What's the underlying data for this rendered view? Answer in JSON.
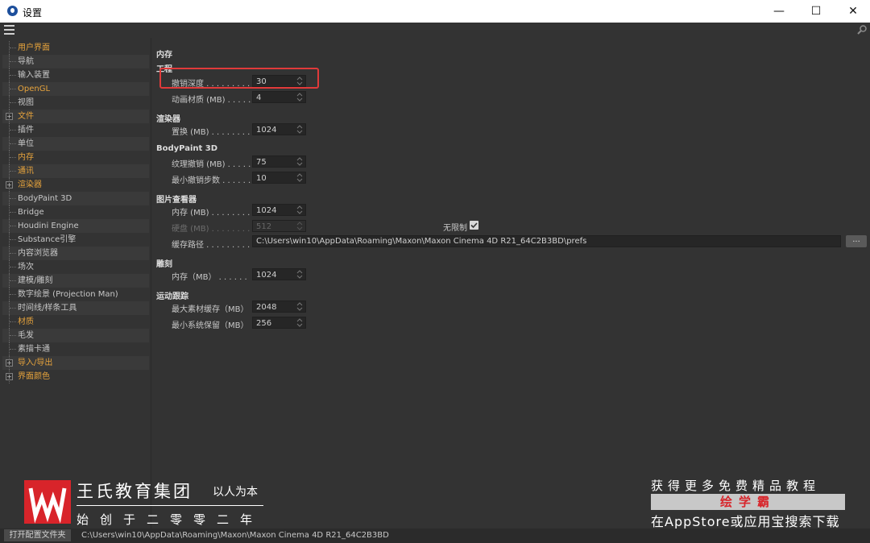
{
  "window": {
    "title": "设置",
    "minimize": "—",
    "maximize": "☐",
    "close": "✕"
  },
  "sidebar": {
    "items": [
      {
        "label": "用户界面",
        "orange": true,
        "expandable": false
      },
      {
        "label": "导航",
        "orange": false,
        "expandable": false
      },
      {
        "label": "输入装置",
        "orange": false,
        "expandable": false
      },
      {
        "label": "OpenGL",
        "orange": true,
        "expandable": false
      },
      {
        "label": "视图",
        "orange": false,
        "expandable": false
      },
      {
        "label": "文件",
        "orange": true,
        "expandable": true
      },
      {
        "label": "插件",
        "orange": false,
        "expandable": false
      },
      {
        "label": "单位",
        "orange": false,
        "expandable": false
      },
      {
        "label": "内存",
        "orange": true,
        "expandable": false
      },
      {
        "label": "通讯",
        "orange": true,
        "expandable": false
      },
      {
        "label": "渲染器",
        "orange": true,
        "expandable": true
      },
      {
        "label": "BodyPaint 3D",
        "orange": false,
        "expandable": false
      },
      {
        "label": "Bridge",
        "orange": false,
        "expandable": false
      },
      {
        "label": "Houdini Engine",
        "orange": false,
        "expandable": false
      },
      {
        "label": "Substance引擎",
        "orange": false,
        "expandable": false
      },
      {
        "label": "内容浏览器",
        "orange": false,
        "expandable": false
      },
      {
        "label": "场次",
        "orange": false,
        "expandable": false
      },
      {
        "label": "建模/雕刻",
        "orange": false,
        "expandable": false
      },
      {
        "label": "数字绘景 (Projection Man)",
        "orange": false,
        "expandable": false
      },
      {
        "label": "时间线/样条工具",
        "orange": false,
        "expandable": false
      },
      {
        "label": "材质",
        "orange": true,
        "expandable": false
      },
      {
        "label": "毛发",
        "orange": false,
        "expandable": false
      },
      {
        "label": "素描卡通",
        "orange": false,
        "expandable": false
      },
      {
        "label": "导入/导出",
        "orange": true,
        "expandable": true
      },
      {
        "label": "界面颜色",
        "orange": true,
        "expandable": true
      }
    ]
  },
  "content": {
    "heading": "内存",
    "project": {
      "heading": "工程",
      "undo_label": "撤销深度",
      "undo_value": "30",
      "anim_label": "动画材质 (MB)",
      "anim_value": "4"
    },
    "renderer": {
      "heading": "渲染器",
      "swap_label": "置换 (MB)",
      "swap_value": "1024"
    },
    "bodypaint": {
      "heading": "BodyPaint 3D",
      "tex_label": "纹理撤销 (MB)",
      "tex_value": "75",
      "min_label": "最小撤销步数",
      "min_value": "10"
    },
    "picture_viewer": {
      "heading": "图片查看器",
      "mem_label": "内存 (MB)",
      "mem_value": "1024",
      "disk_label": "硬盘 (MB)",
      "disk_value": "512",
      "unlimited_label": "无限制",
      "unlimited_checked": true,
      "cache_label": "缓存路径",
      "cache_value": "C:\\Users\\win10\\AppData\\Roaming\\Maxon\\Maxon Cinema 4D R21_64C2B3BD\\prefs",
      "browse": "..."
    },
    "sculpt": {
      "heading": "雕刻",
      "mem_label": "内存（MB）",
      "mem_value": "1024"
    },
    "tracker": {
      "heading": "运动跟踪",
      "max_label": "最大素材缓存（MB）",
      "max_value": "2048",
      "min_label": "最小系统保留（MB）",
      "min_value": "256"
    }
  },
  "watermark": {
    "company": "王氏教育集团",
    "slogan": "以人为本",
    "since": "始创于二零零二年",
    "more": "获得更多免费精品教程",
    "brand": "绘学霸",
    "store": "在AppStore或应用宝搜索下载"
  },
  "status": {
    "open_button": "打开配置文件夹",
    "path": "C:\\Users\\win10\\AppData\\Roaming\\Maxon\\Maxon Cinema 4D R21_64C2B3BD"
  },
  "colors": {
    "background": "#333333",
    "accent_orange": "#e6a33c",
    "highlight_red": "#e03a3a",
    "logo_red": "#d8242a"
  }
}
